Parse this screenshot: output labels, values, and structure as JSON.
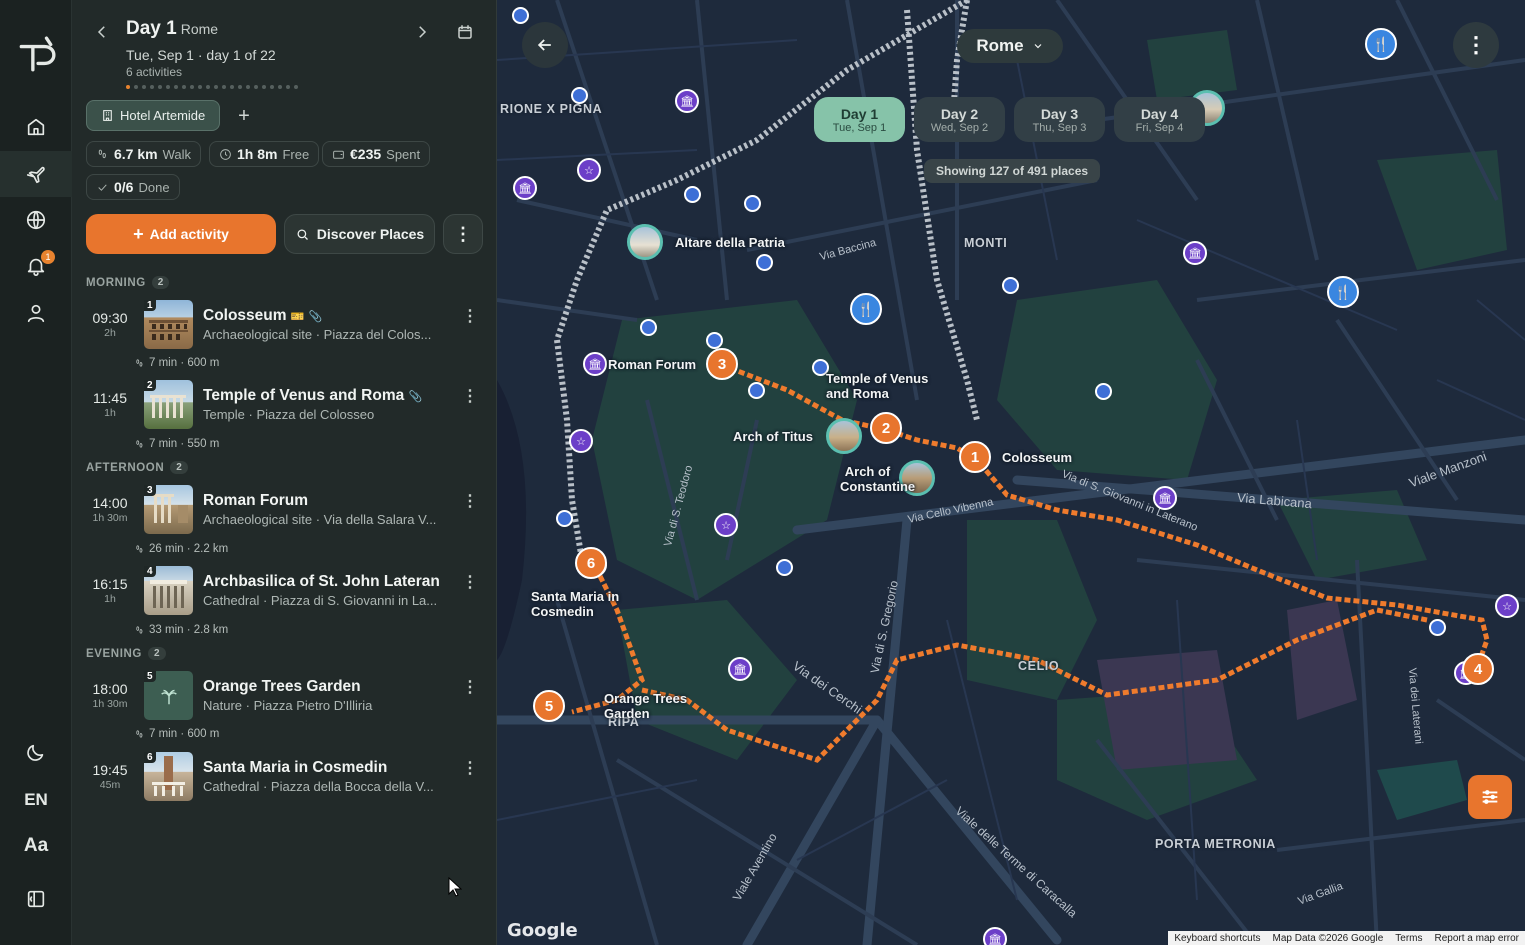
{
  "rail": {
    "items": [
      "home",
      "trips",
      "explore",
      "notifications",
      "profile"
    ],
    "notification_count": "1",
    "language": "EN",
    "font_label": "Aa"
  },
  "day_header": {
    "title": "Day 1",
    "city": "Rome",
    "subtitle": "Tue, Sep 1 · day 1 of 22",
    "activities": "6 activities",
    "dots_total": 22,
    "dots_active": 1
  },
  "hotel": {
    "label": "Hotel Artemide"
  },
  "stats": {
    "walk_value": "6.7 km",
    "walk_label": "Walk",
    "free_value": "1h 8m",
    "free_label": "Free",
    "spent_value": "€235",
    "spent_label": "Spent",
    "done_value": "0/6",
    "done_label": "Done"
  },
  "actions": {
    "add": "Add activity",
    "discover": "Discover Places"
  },
  "sections": {
    "morning": {
      "label": "MORNING",
      "count": "2"
    },
    "afternoon": {
      "label": "AFTERNOON",
      "count": "2"
    },
    "evening": {
      "label": "EVENING",
      "count": "2"
    }
  },
  "activities": [
    {
      "num": "1",
      "time": "09:30",
      "dur": "2h",
      "name": "Colosseum",
      "meta": "Archaeological site · Piazza del Colos..."
    },
    {
      "num": "2",
      "time": "11:45",
      "dur": "1h",
      "name": "Temple of Venus and Roma",
      "meta": "Temple · Piazza del Colosseo"
    },
    {
      "num": "3",
      "time": "14:00",
      "dur": "1h 30m",
      "name": "Roman Forum",
      "meta": "Archaeological site · Via della Salara V..."
    },
    {
      "num": "4",
      "time": "16:15",
      "dur": "1h",
      "name": "Archbasilica of St. John Lateran",
      "meta": "Cathedral · Piazza di S. Giovanni in La..."
    },
    {
      "num": "5",
      "time": "18:00",
      "dur": "1h 30m",
      "name": "Orange Trees Garden",
      "meta": "Nature · Piazza Pietro D'Illiria"
    },
    {
      "num": "6",
      "time": "19:45",
      "dur": "45m",
      "name": "Santa Maria in Cosmedin",
      "meta": "Cathedral · Piazza della Bocca della V..."
    }
  ],
  "travel": [
    "7 min · 600 m",
    "7 min · 550 m",
    "26 min · 2.2 km",
    "33 min · 2.8 km",
    "7 min · 600 m"
  ],
  "map": {
    "city": "Rome",
    "showing": "Showing 127 of 491 places",
    "tabs": [
      {
        "day": "Day 1",
        "date": "Tue, Sep 1"
      },
      {
        "day": "Day 2",
        "date": "Wed, Sep 2"
      },
      {
        "day": "Day 3",
        "date": "Thu, Sep 3"
      },
      {
        "day": "Day 4",
        "date": "Fri, Sep 4"
      }
    ],
    "labels": {
      "altare": "Altare della Patria",
      "forum": "Roman Forum",
      "temple": "Temple of Venus and Roma",
      "titus": "Arch of Titus",
      "constantine": "Arch of Constantine",
      "colosseum": "Colosseum",
      "santa_maria": "Santa Maria in Cosmedin",
      "orange": "Orange Trees Garden"
    },
    "districts": {
      "monti": "MONTI",
      "pigna": "RIONE X PIGNA",
      "celio": "CELIO",
      "ripa": "RIPA",
      "metronia": "PORTA METRONIA"
    },
    "streets": {
      "baccina": "Via Baccina",
      "labicana": "Via Labicana",
      "manzoni": "Viale Manzoni",
      "cerchi": "Via dei Cerchi",
      "gregorio": "Via di S. Gregorio",
      "caracalla": "Viale delle Terme di Caracalla",
      "giovanni": "Via di S. Giovanni in Laterano",
      "cello": "Via Cello Vibenna",
      "aventino": "Viale Aventino",
      "metronia": "Via Gallia",
      "lateran": "Via dei Laterani",
      "teodoro": "Via di S. Teodoro"
    },
    "footer": [
      "Keyboard shortcuts",
      "Map Data ©2026 Google",
      "Terms",
      "Report a map error"
    ],
    "google": "Google",
    "colors": {
      "route": "#e8752d",
      "accent": "#86c3a9",
      "pin_blue": "#3e6fd6",
      "pin_purple": "#6c3fc8"
    }
  }
}
